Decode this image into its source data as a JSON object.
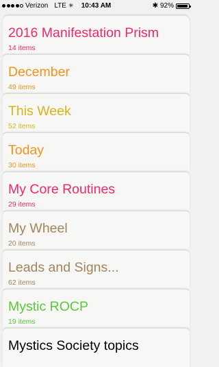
{
  "status_bar": {
    "carrier": "Verizon",
    "network": "LTE",
    "time": "10:43 AM",
    "battery_percent": "92%",
    "battery_level": 0.92,
    "icons": [
      "signal-dots-icon",
      "activity-spinner-icon",
      "bluetooth-icon",
      "battery-icon"
    ]
  },
  "lists": [
    {
      "title": "2016 Manifestation Prism",
      "count": "14 items",
      "color": "#f0286e"
    },
    {
      "title": "December",
      "count": "49 items",
      "color": "#f4921e"
    },
    {
      "title": "This Week",
      "count": "52 items",
      "color": "#d9b51a"
    },
    {
      "title": "Today",
      "count": "30 items",
      "color": "#f4921e"
    },
    {
      "title": "My Core Routines",
      "count": "29 items",
      "color": "#f0286e"
    },
    {
      "title": "My Wheel",
      "count": "20 items",
      "color": "#a2845e"
    },
    {
      "title": "Leads and Signs...",
      "count": "62 items",
      "color": "#a2845e"
    },
    {
      "title": "Mystic ROCP",
      "count": "19 items",
      "color": "#5ac83a"
    },
    {
      "title": "Mystics Society topics",
      "count": "",
      "color": "#000000"
    }
  ]
}
